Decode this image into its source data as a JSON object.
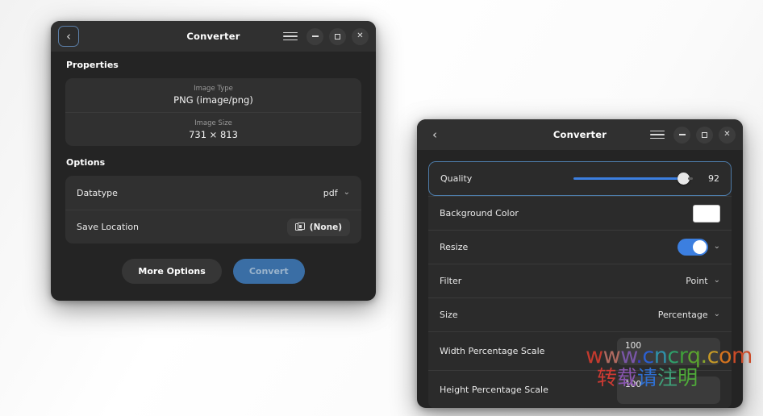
{
  "window1": {
    "title": "Converter",
    "back_icon": "chevron-left-icon",
    "menu_icon": "hamburger-menu-icon",
    "minimize_icon": "minimize-icon",
    "maximize_icon": "maximize-icon",
    "close_icon": "close-icon",
    "properties": {
      "heading": "Properties",
      "items": [
        {
          "label": "Image Type",
          "value": "PNG (image/png)"
        },
        {
          "label": "Image Size",
          "value": "731 × 813"
        }
      ]
    },
    "options": {
      "heading": "Options",
      "datatype": {
        "label": "Datatype",
        "value": "pdf",
        "chevron": "chevron-down-icon"
      },
      "save_location": {
        "label": "Save Location",
        "value": "(None)",
        "icon": "folder-icon"
      }
    },
    "buttons": {
      "more_options": "More Options",
      "convert": "Convert"
    }
  },
  "window2": {
    "title": "Converter",
    "back_icon": "chevron-left-icon",
    "menu_icon": "hamburger-menu-icon",
    "minimize_icon": "minimize-icon",
    "maximize_icon": "maximize-icon",
    "close_icon": "close-icon",
    "rows": {
      "quality": {
        "label": "Quality",
        "value": "92",
        "min": 0,
        "max": 100
      },
      "background_color": {
        "label": "Background Color",
        "color": "#ffffff"
      },
      "resize": {
        "label": "Resize",
        "enabled": true,
        "chevron": "chevron-down-icon"
      },
      "filter": {
        "label": "Filter",
        "value": "Point",
        "chevron": "chevron-down-icon"
      },
      "size": {
        "label": "Size",
        "value": "Percentage",
        "chevron": "chevron-down-icon"
      },
      "width_scale": {
        "label": "Width Percentage Scale",
        "value": "100"
      },
      "height_scale": {
        "label": "Height Percentage Scale",
        "value": "100"
      }
    }
  },
  "watermark": {
    "latin": [
      {
        "ch": "w",
        "color": "#c33a2e"
      },
      {
        "ch": "w",
        "color": "#b06a60"
      },
      {
        "ch": "w",
        "color": "#7a56a8"
      },
      {
        "ch": ".",
        "color": "#3b3bc8"
      },
      {
        "ch": "c",
        "color": "#2b5fd0"
      },
      {
        "ch": "n",
        "color": "#2f8fa8"
      },
      {
        "ch": "c",
        "color": "#2f9f6a"
      },
      {
        "ch": "r",
        "color": "#3f9e3a"
      },
      {
        "ch": "q",
        "color": "#5aa32e"
      },
      {
        "ch": ".",
        "color": "#8aa82a"
      },
      {
        "ch": "c",
        "color": "#c79a26"
      },
      {
        "ch": "o",
        "color": "#d4731f"
      },
      {
        "ch": "m",
        "color": "#cc4b28"
      }
    ],
    "cjk": [
      {
        "ch": "转",
        "color": "#cc3a33"
      },
      {
        "ch": "载",
        "color": "#8a55b0"
      },
      {
        "ch": "请",
        "color": "#2f6fd0"
      },
      {
        "ch": "注",
        "color": "#3f9f78"
      },
      {
        "ch": "明",
        "color": "#4faa3a"
      }
    ]
  }
}
